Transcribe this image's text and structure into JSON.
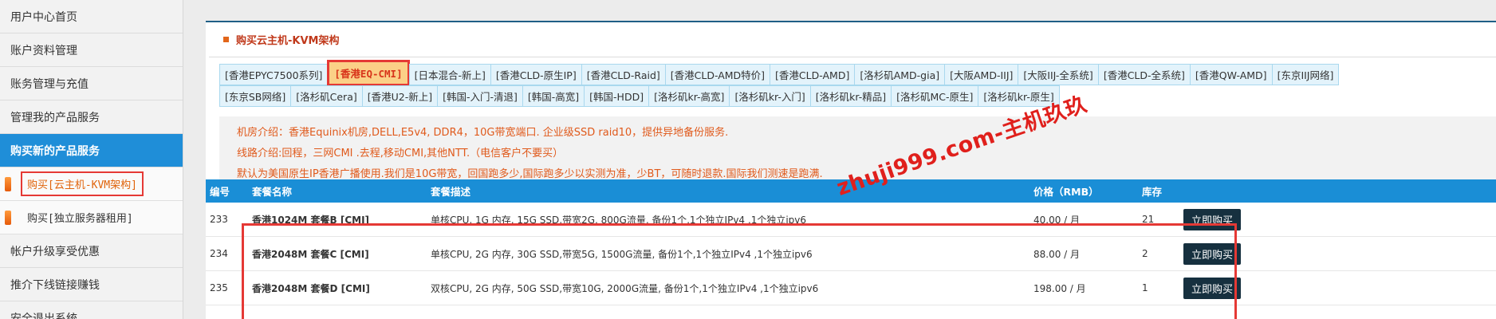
{
  "sidebar": {
    "items_top": [
      {
        "label": "用户中心首页"
      },
      {
        "label": "账户资料管理"
      },
      {
        "label": "账务管理与充值"
      },
      {
        "label": "管理我的产品服务"
      }
    ],
    "active_item": {
      "label": "购买新的产品服务"
    },
    "sub_items": [
      {
        "label": "购买[云主机-KVM架构]"
      },
      {
        "label": "购买[独立服务器租用]"
      }
    ],
    "items_bottom": [
      {
        "label": "帐户升级享受优惠"
      },
      {
        "label": "推介下线链接赚钱"
      },
      {
        "label": "安全退出系统"
      }
    ]
  },
  "panel": {
    "title": "购买云主机-KVM架构",
    "tabs_row1": [
      "[香港EPYC7500系列]",
      "[香港EQ-CMI]",
      "[日本混合-新上]",
      "[香港CLD-原生IP]",
      "[香港CLD-Raid]",
      "[香港CLD-AMD特价]",
      "[香港CLD-AMD]",
      "[洛杉矶AMD-gia]",
      "[大阪AMD-IIJ]",
      "[大阪IIJ-全系统]",
      "[香港CLD-全系统]",
      "[香港QW-AMD]",
      "[东京IIJ网络]"
    ],
    "tabs_row2": [
      "[东京SB网络]",
      "[洛杉矶Cera]",
      "[香港U2-新上]",
      "[韩国-入门-清退]",
      "[韩国-高宽]",
      "[韩国-HDD]",
      "[洛杉矶kr-高宽]",
      "[洛杉矶kr-入门]",
      "[洛杉矶kr-精品]",
      "[洛杉矶MC-原生]",
      "[洛杉矶kr-原生]"
    ],
    "active_tab": "[香港EQ-CMI]",
    "info": {
      "line1": "机房介绍：香港Equinix机房,DELL,E5v4, DDR4，10G带宽端口. 企业级SSD raid10，提供异地备份服务.",
      "line2": "线路介绍:回程，三网CMI .去程,移动CMI,其他NTT.（电信客户不要买）",
      "line3": "默认为美国原生IP香港广播使用.我们是10G带宽，回国跑多少,国际跑多少以实测为准，少BT，可随时退款.国际我们测速是跑满."
    },
    "watermark": "zhuji999.com-主机玖玖"
  },
  "table": {
    "headers": {
      "id": "编号",
      "name": "套餐名称",
      "desc": "套餐描述",
      "price": "价格（RMB）",
      "stock": "库存"
    },
    "rows": [
      {
        "id": "233",
        "name": "香港1024M 套餐B [CMI]",
        "desc": "单核CPU, 1G 内存, 15G SSD,带宽2G, 800G流量, 备份1个,1个独立IPv4 ,1个独立ipv6",
        "price": "40.00 / 月",
        "stock": "21",
        "buy": "立即购买"
      },
      {
        "id": "234",
        "name": "香港2048M 套餐C [CMI]",
        "desc": "单核CPU, 2G 内存, 30G SSD,带宽5G, 1500G流量, 备份1个,1个独立IPv4 ,1个独立ipv6",
        "price": "88.00 / 月",
        "stock": "2",
        "buy": "立即购买"
      },
      {
        "id": "235",
        "name": "香港2048M 套餐D [CMI]",
        "desc": "双核CPU, 2G 内存, 50G SSD,带宽10G, 2000G流量, 备份1个,1个独立IPv4 ,1个独立ipv6",
        "price": "198.00 / 月",
        "stock": "1",
        "buy": "立即购买"
      }
    ]
  },
  "colors": {
    "accent": "#1a8ed6",
    "highlight": "#e53935",
    "info_text": "#e05a1c",
    "button": "#16303f"
  }
}
